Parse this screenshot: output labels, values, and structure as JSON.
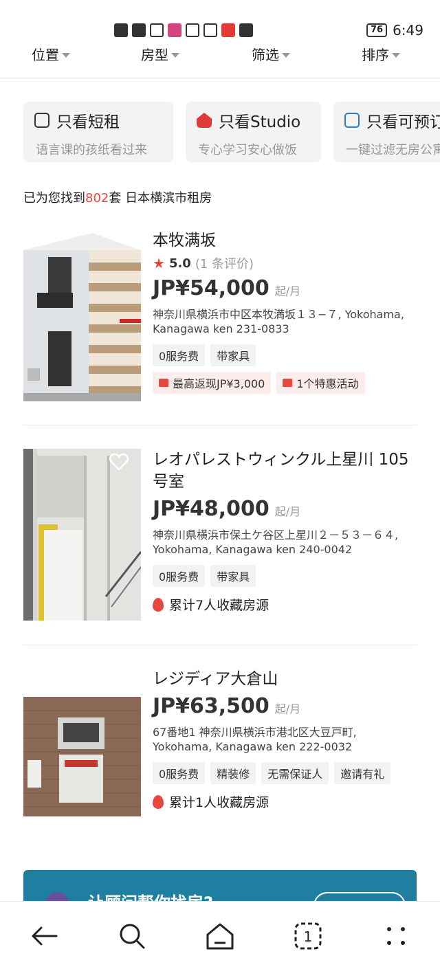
{
  "status_bar": {
    "battery": "76",
    "time": "6:49"
  },
  "filters": [
    "位置",
    "房型",
    "筛选",
    "排序"
  ],
  "quick_filters": [
    {
      "title": "只看短租",
      "subtitle": "语言课的孩纸看过来",
      "icon": "luggage-icon"
    },
    {
      "title": "只看Studio",
      "subtitle": "专心学习安心做饭",
      "icon": "house-icon"
    },
    {
      "title": "只看可预订",
      "subtitle": "一键过滤无房公寓",
      "icon": "calendar-check-icon"
    }
  ],
  "result": {
    "prefix": "已为您找到",
    "count": "802",
    "suffix": "套  日本横滨市租房"
  },
  "listings": [
    {
      "title": "本牧满坂",
      "rating": "5.0",
      "review_count": "(1 条评价)",
      "price": "JP¥54,000",
      "unit": "起/月",
      "address": "神奈川県横浜市中区本牧満坂１３−７, Yokohama, Kanagawa ken 231-0833",
      "tags": [
        "0服务费",
        "带家具"
      ],
      "promos": [
        "最高返现JP¥3,000",
        "1个特惠活动"
      ]
    },
    {
      "title": "レオパレストウィンクル上星川 105号室",
      "price": "JP¥48,000",
      "unit": "起/月",
      "address": "神奈川県横浜市保土ケ谷区上星川２－５３－６４, Yokohama, Kanagawa ken 240-0042",
      "tags": [
        "0服务费",
        "带家具"
      ],
      "favorites": "累计7人收藏房源"
    },
    {
      "title": "レジディア大倉山",
      "price": "JP¥63,500",
      "unit": "起/月",
      "address": "67番地1 神奈川県横浜市港北区大豆戸町, Yokohama, Kanagawa ken 222-0032",
      "tags": [
        "0服务费",
        "精装修",
        "无需保证人",
        "邀请有礼"
      ],
      "favorites": "累计1人收藏房源"
    }
  ],
  "banner": {
    "text": "让顾问帮你找房?"
  },
  "colors": {
    "accent": "#e5483f",
    "banner": "#1f7fa0"
  }
}
